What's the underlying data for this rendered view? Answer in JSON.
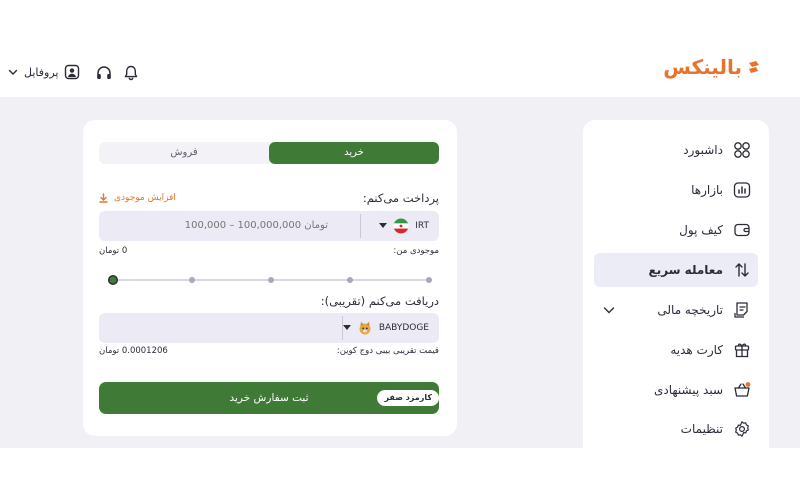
{
  "brand": {
    "logo_text": "بالینکس",
    "logo_color": "#e8732c"
  },
  "header": {
    "profile_label": "پروفایل"
  },
  "sidebar": {
    "items": [
      {
        "label": "داشبورد",
        "icon": "dashboard-grid-icon"
      },
      {
        "label": "بازارها",
        "icon": "markets-chart-icon"
      },
      {
        "label": "کیف پول",
        "icon": "wallet-icon"
      },
      {
        "label": "معامله سریع",
        "icon": "swap-arrows-icon",
        "active": true
      },
      {
        "label": "تاریخچه مالی",
        "icon": "history-receipt-icon",
        "expandable": true
      },
      {
        "label": "کارت هدیه",
        "icon": "gift-card-icon"
      },
      {
        "label": "سبد پیشنهادی",
        "icon": "basket-icon"
      },
      {
        "label": "تنظیمات",
        "icon": "settings-gear-icon"
      }
    ]
  },
  "trade": {
    "tabs": {
      "buy": "خرید",
      "sell": "فروش"
    },
    "pay": {
      "label": "پرداخت می‌کنم:",
      "deposit_link": "افزایش موجودی",
      "currency": "IRT",
      "placeholder": "100,000 – 100,000,000 تومان",
      "balance_label": "موجودی من:",
      "balance_value": "0 تومان"
    },
    "slider": {
      "percent": 0,
      "steps": 5
    },
    "receive": {
      "label": "دریافت می‌کنم (تقریبی):",
      "currency": "BABYDOGE",
      "price_label": "قیمت تقریبی بیبی دوج کوین:",
      "price_value": "0.0001206 تومان"
    },
    "submit": {
      "label": "ثبت سفارش خرید",
      "fee_badge": "کارمزد صفر"
    }
  },
  "colors": {
    "primary_green": "#3f7a37",
    "accent_orange": "#e8732c",
    "background": "#f0f0f5"
  }
}
